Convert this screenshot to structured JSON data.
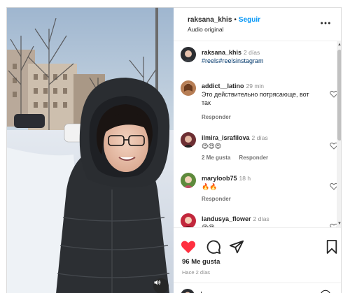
{
  "post": {
    "author": "raksana_khis",
    "separator": "•",
    "follow_label": "Seguir",
    "audio_label": "Audio original",
    "more_icon": "more-horizontal-icon",
    "audio_icon": "speaker-icon"
  },
  "comments": [
    {
      "user": "raksana_khis",
      "time": "2 días",
      "text": "",
      "tags": "#reels#reelsinstagram",
      "reply": "",
      "likes": "",
      "is_caption": true
    },
    {
      "user": "addict__latino",
      "time": "29 min",
      "text": "Это действительно потрясающе, вот так",
      "tags": "",
      "reply": "Responder",
      "likes": ""
    },
    {
      "user": "ilmira_israfilova",
      "time": "2 días",
      "text": "😍😍😍",
      "tags": "",
      "reply": "Responder",
      "likes": "2 Me gusta"
    },
    {
      "user": "maryloob75",
      "time": "18 h",
      "text": "🔥🔥",
      "tags": "",
      "reply": "Responder",
      "likes": ""
    },
    {
      "user": "landusya_flower",
      "time": "2 días",
      "text": "😍😍",
      "tags": "",
      "reply": "",
      "likes": ""
    }
  ],
  "actions": {
    "like_icon": "heart-filled-icon",
    "comment_icon": "comment-icon",
    "share_icon": "send-icon",
    "save_icon": "bookmark-icon",
    "like_color": "#ff3040",
    "likes_count": "96 Me gusta",
    "posted_ago": "Hace 2 días"
  },
  "composer": {
    "placeholder": "Añade un comentario...",
    "emoji_icon": "emoji-icon"
  },
  "colors": {
    "link_blue": "#0095f6",
    "hashtag": "#00376b",
    "muted": "#8e8e8e",
    "like_red": "#ff3040"
  }
}
